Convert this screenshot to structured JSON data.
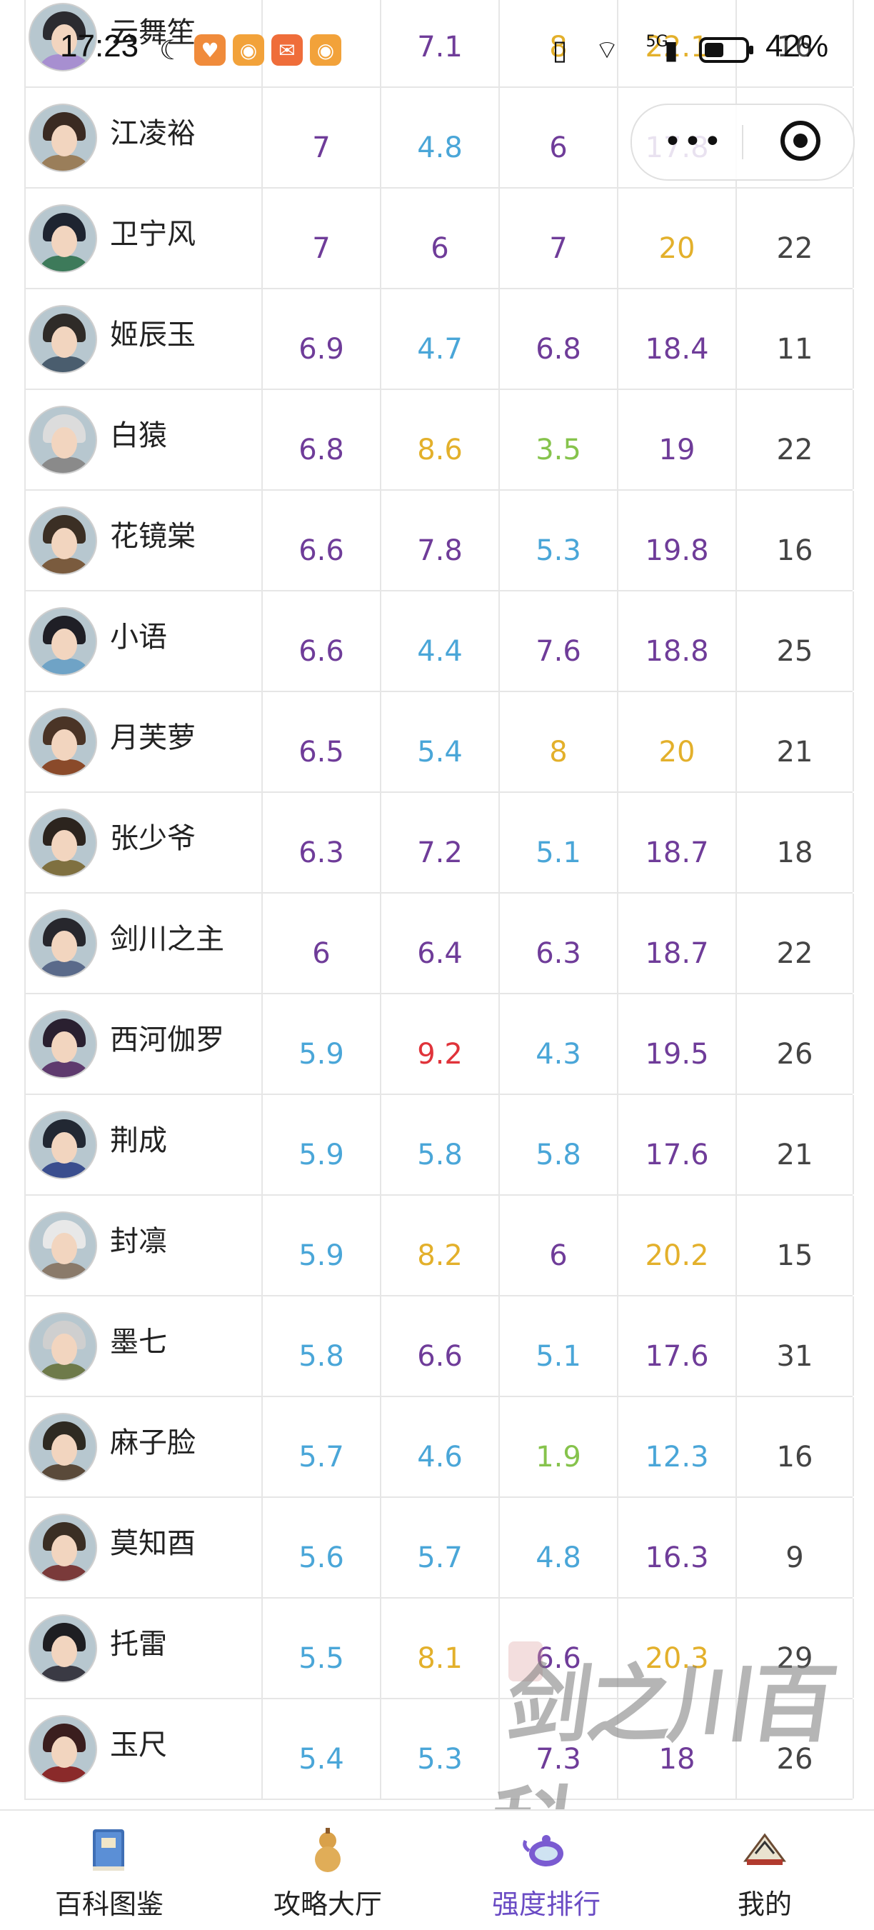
{
  "status_bar": {
    "time": "17:23",
    "battery": "42%",
    "network": "5G"
  },
  "colors": {
    "purple": "#6f3c99",
    "blue": "#4aa6d8",
    "gold": "#e3b02b",
    "green": "#86c34c",
    "red": "#e0333a",
    "gray": "#444444",
    "nav_active": "#6a4bc4"
  },
  "rows": [
    {
      "name": "云舞笙",
      "values": [
        {
          "v": "7",
          "c": "purple"
        },
        {
          "v": "7.1",
          "c": "purple"
        },
        {
          "v": "8",
          "c": "gold"
        },
        {
          "v": "22.1",
          "c": "gold"
        },
        {
          "v": "16",
          "c": "gray"
        }
      ]
    },
    {
      "name": "江凌裕",
      "values": [
        {
          "v": "7",
          "c": "purple"
        },
        {
          "v": "4.8",
          "c": "blue"
        },
        {
          "v": "6",
          "c": "purple"
        },
        {
          "v": "17.8",
          "c": "purple"
        },
        {
          "v": "",
          "c": "gray"
        }
      ]
    },
    {
      "name": "卫宁风",
      "values": [
        {
          "v": "7",
          "c": "purple"
        },
        {
          "v": "6",
          "c": "purple"
        },
        {
          "v": "7",
          "c": "purple"
        },
        {
          "v": "20",
          "c": "gold"
        },
        {
          "v": "22",
          "c": "gray"
        }
      ]
    },
    {
      "name": "姬辰玉",
      "values": [
        {
          "v": "6.9",
          "c": "purple"
        },
        {
          "v": "4.7",
          "c": "blue"
        },
        {
          "v": "6.8",
          "c": "purple"
        },
        {
          "v": "18.4",
          "c": "purple"
        },
        {
          "v": "11",
          "c": "gray"
        }
      ]
    },
    {
      "name": "白猿",
      "values": [
        {
          "v": "6.8",
          "c": "purple"
        },
        {
          "v": "8.6",
          "c": "gold"
        },
        {
          "v": "3.5",
          "c": "green"
        },
        {
          "v": "19",
          "c": "purple"
        },
        {
          "v": "22",
          "c": "gray"
        }
      ]
    },
    {
      "name": "花镜棠",
      "values": [
        {
          "v": "6.6",
          "c": "purple"
        },
        {
          "v": "7.8",
          "c": "purple"
        },
        {
          "v": "5.3",
          "c": "blue"
        },
        {
          "v": "19.8",
          "c": "purple"
        },
        {
          "v": "16",
          "c": "gray"
        }
      ]
    },
    {
      "name": "小语",
      "values": [
        {
          "v": "6.6",
          "c": "purple"
        },
        {
          "v": "4.4",
          "c": "blue"
        },
        {
          "v": "7.6",
          "c": "purple"
        },
        {
          "v": "18.8",
          "c": "purple"
        },
        {
          "v": "25",
          "c": "gray"
        }
      ]
    },
    {
      "name": "月芙萝",
      "values": [
        {
          "v": "6.5",
          "c": "purple"
        },
        {
          "v": "5.4",
          "c": "blue"
        },
        {
          "v": "8",
          "c": "gold"
        },
        {
          "v": "20",
          "c": "gold"
        },
        {
          "v": "21",
          "c": "gray"
        }
      ]
    },
    {
      "name": "张少爷",
      "values": [
        {
          "v": "6.3",
          "c": "purple"
        },
        {
          "v": "7.2",
          "c": "purple"
        },
        {
          "v": "5.1",
          "c": "blue"
        },
        {
          "v": "18.7",
          "c": "purple"
        },
        {
          "v": "18",
          "c": "gray"
        }
      ]
    },
    {
      "name": "剑川之主",
      "values": [
        {
          "v": "6",
          "c": "purple"
        },
        {
          "v": "6.4",
          "c": "purple"
        },
        {
          "v": "6.3",
          "c": "purple"
        },
        {
          "v": "18.7",
          "c": "purple"
        },
        {
          "v": "22",
          "c": "gray"
        }
      ]
    },
    {
      "name": "西河伽罗",
      "values": [
        {
          "v": "5.9",
          "c": "blue"
        },
        {
          "v": "9.2",
          "c": "red"
        },
        {
          "v": "4.3",
          "c": "blue"
        },
        {
          "v": "19.5",
          "c": "purple"
        },
        {
          "v": "26",
          "c": "gray"
        }
      ]
    },
    {
      "name": "荆成",
      "values": [
        {
          "v": "5.9",
          "c": "blue"
        },
        {
          "v": "5.8",
          "c": "blue"
        },
        {
          "v": "5.8",
          "c": "blue"
        },
        {
          "v": "17.6",
          "c": "purple"
        },
        {
          "v": "21",
          "c": "gray"
        }
      ]
    },
    {
      "name": "封凛",
      "values": [
        {
          "v": "5.9",
          "c": "blue"
        },
        {
          "v": "8.2",
          "c": "gold"
        },
        {
          "v": "6",
          "c": "purple"
        },
        {
          "v": "20.2",
          "c": "gold"
        },
        {
          "v": "15",
          "c": "gray"
        }
      ]
    },
    {
      "name": "墨七",
      "values": [
        {
          "v": "5.8",
          "c": "blue"
        },
        {
          "v": "6.6",
          "c": "purple"
        },
        {
          "v": "5.1",
          "c": "blue"
        },
        {
          "v": "17.6",
          "c": "purple"
        },
        {
          "v": "31",
          "c": "gray"
        }
      ]
    },
    {
      "name": "麻子脸",
      "values": [
        {
          "v": "5.7",
          "c": "blue"
        },
        {
          "v": "4.6",
          "c": "blue"
        },
        {
          "v": "1.9",
          "c": "green"
        },
        {
          "v": "12.3",
          "c": "blue"
        },
        {
          "v": "16",
          "c": "gray"
        }
      ]
    },
    {
      "name": "莫知酉",
      "values": [
        {
          "v": "5.6",
          "c": "blue"
        },
        {
          "v": "5.7",
          "c": "blue"
        },
        {
          "v": "4.8",
          "c": "blue"
        },
        {
          "v": "16.3",
          "c": "purple"
        },
        {
          "v": "9",
          "c": "gray"
        }
      ]
    },
    {
      "name": "托雷",
      "values": [
        {
          "v": "5.5",
          "c": "blue"
        },
        {
          "v": "8.1",
          "c": "gold"
        },
        {
          "v": "6.6",
          "c": "purple"
        },
        {
          "v": "20.3",
          "c": "gold"
        },
        {
          "v": "29",
          "c": "gray"
        }
      ]
    },
    {
      "name": "玉尺",
      "values": [
        {
          "v": "5.4",
          "c": "blue"
        },
        {
          "v": "5.3",
          "c": "blue"
        },
        {
          "v": "7.3",
          "c": "purple"
        },
        {
          "v": "18",
          "c": "purple"
        },
        {
          "v": "26",
          "c": "gray"
        }
      ]
    }
  ],
  "watermark": "剑之川百科",
  "nav": [
    {
      "label": "百科图鉴",
      "icon": "encyclopedia-book-icon",
      "active": false
    },
    {
      "label": "攻略大厅",
      "icon": "gourd-icon",
      "active": false
    },
    {
      "label": "强度排行",
      "icon": "teapot-icon",
      "active": true
    },
    {
      "label": "我的",
      "icon": "fan-scroll-icon",
      "active": false
    }
  ]
}
